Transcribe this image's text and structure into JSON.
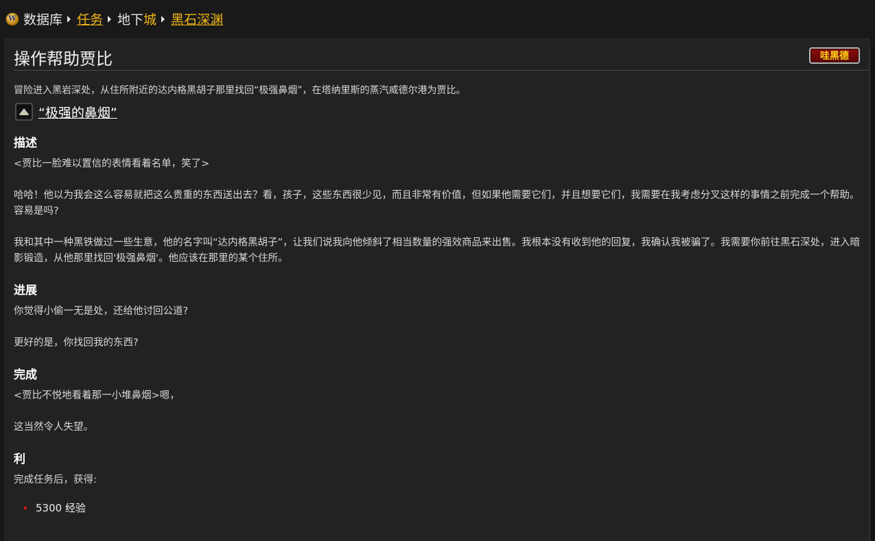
{
  "breadcrumb": {
    "icon": "wow-logo-icon",
    "logo_letter": "W",
    "items": [
      {
        "label": "数据库",
        "link": false
      },
      {
        "label": "任务",
        "link": true
      },
      {
        "label_prefix": "地下",
        "label_highlight": "城",
        "link": false
      },
      {
        "label": "黑石深渊",
        "link": true
      }
    ]
  },
  "quest": {
    "title": "操作帮助贾比",
    "faction_badge": "哇黑德",
    "objective": "冒险进入黑岩深处，从住所附近的达内格黑胡子那里找回“极强鼻烟”，在塔纳里斯的蒸汽威德尔港为贾比。",
    "item": {
      "icon": "snuff-pouch-icon",
      "label": "“极强的鼻烟”"
    }
  },
  "sections": {
    "description": {
      "heading": "描述",
      "paragraphs": [
        "<贾比一脸难以置信的表情看着名单，笑了>",
        "哈哈！他以为我会这么容易就把这么贵重的东西送出去？看，孩子，这些东西很少见，而且非常有价值，但如果他需要它们，并且想要它们，我需要在我考虑分叉这样的事情之前完成一个帮助。容易是吗?",
        "我和其中一种黑铁做过一些生意，他的名字叫“达内格黑胡子”，让我们说我向他倾斜了相当数量的强效商品来出售。我根本没有收到他的回复，我确认我被骗了。我需要你前往黑石深处，进入暗影锻造，从他那里找回'极强鼻烟'。他应该在那里的某个住所。"
      ]
    },
    "progress": {
      "heading": "进展",
      "paragraphs": [
        "你觉得小偷一无是处，还给他讨回公道?",
        "更好的是，你找回我的东西?"
      ]
    },
    "completion": {
      "heading": "完成",
      "paragraphs": [
        "<贾比不悦地看着那一小堆鼻烟>嗯，",
        "这当然令人失望。"
      ]
    },
    "rewards": {
      "heading": "利",
      "intro": "完成任务后，获得:",
      "items": [
        "5300 经验"
      ]
    }
  },
  "colors": {
    "link_gold": "#f0b418",
    "background": "#222222",
    "badge_red": "#8a0b0b",
    "bullet_red": "#d01818"
  }
}
